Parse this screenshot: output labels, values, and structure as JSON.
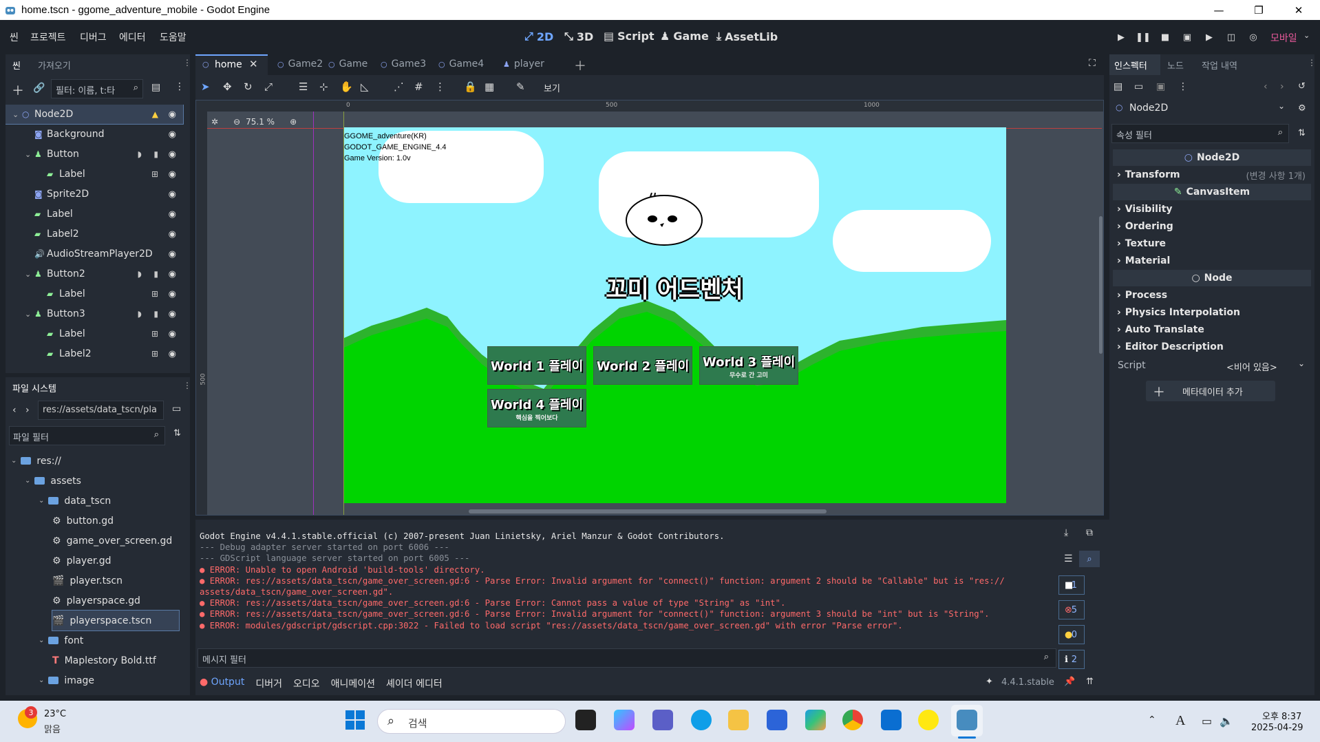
{
  "window": {
    "title": "home.tscn - ggome_adventure_mobile - Godot Engine",
    "minimize": "—",
    "maximize": "❐",
    "close": "✕"
  },
  "menu": [
    "씬",
    "프로젝트",
    "디버그",
    "에디터",
    "도움말"
  ],
  "main_screens": [
    "2D",
    "3D",
    "Script",
    "Game",
    "AssetLib"
  ],
  "renderer": "모바일",
  "scene_dock": {
    "tabs": [
      "씬",
      "가져오기"
    ],
    "filter_placeholder": "필터: 이름, t:타",
    "nodes": [
      {
        "name": "Node2D",
        "icon": "node2d-icon",
        "color": "#8da5f3"
      },
      {
        "name": "Background",
        "icon": "sprite-icon",
        "color": "#8da5f3"
      },
      {
        "name": "Button",
        "icon": "button-icon",
        "color": "#8eef97"
      },
      {
        "name": "Label",
        "icon": "label-icon",
        "color": "#8eef97"
      },
      {
        "name": "Sprite2D",
        "icon": "sprite-icon",
        "color": "#8da5f3"
      },
      {
        "name": "Label",
        "icon": "label-icon",
        "color": "#8eef97"
      },
      {
        "name": "Label2",
        "icon": "label-icon",
        "color": "#8eef97"
      },
      {
        "name": "AudioStreamPlayer2D",
        "icon": "audio-icon",
        "color": "#8da5f3"
      },
      {
        "name": "Button2",
        "icon": "button-icon",
        "color": "#8eef97"
      },
      {
        "name": "Label",
        "icon": "label-icon",
        "color": "#8eef97"
      },
      {
        "name": "Button3",
        "icon": "button-icon",
        "color": "#8eef97"
      },
      {
        "name": "Label",
        "icon": "label-icon",
        "color": "#8eef97"
      },
      {
        "name": "Label2",
        "icon": "label-icon",
        "color": "#8eef97"
      }
    ]
  },
  "filesystem": {
    "title": "파일 시스템",
    "path": "res://assets/data_tscn/pla",
    "filter_placeholder": "파일 필터",
    "items": [
      "res://",
      "assets",
      "data_tscn",
      "button.gd",
      "game_over_screen.gd",
      "player.gd",
      "player.tscn",
      "playerspace.gd",
      "playerspace.tscn",
      "font",
      "Maplestory Bold.ttf",
      "image"
    ]
  },
  "scene_tabs": [
    "home",
    "Game2",
    "Game",
    "Game3",
    "Game4",
    "player"
  ],
  "viewport": {
    "zoom": "75.1 %",
    "view_menu": "보기",
    "ruler": [
      "0",
      "500",
      "1000"
    ],
    "ruler_v": [
      "500"
    ],
    "info_lines": [
      "GGOME_adventure(KR)",
      "GODOT_GAME_ENGINE_4.4",
      "Game Version: 1.0v"
    ],
    "game_title": "꼬미 어드벤처",
    "buttons": [
      {
        "label": "World 1 플레이",
        "sub": ""
      },
      {
        "label": "World 2 플레이",
        "sub": ""
      },
      {
        "label": "World 3 플레이",
        "sub": "무수로 간 고미"
      },
      {
        "label": "World 4 플레이",
        "sub": "핵심을 찍어보다"
      }
    ]
  },
  "output": {
    "lines": [
      {
        "kind": "white",
        "text": "Godot Engine v4.4.1.stable.official (c) 2007-present Juan Linietsky, Ariel Manzur & Godot Contributors."
      },
      {
        "kind": "dim",
        "text": "--- Debug adapter server started on port 6006 ---"
      },
      {
        "kind": "dim",
        "text": "--- GDScript language server started on port 6005 ---"
      },
      {
        "kind": "err",
        "text": "● ERROR: Unable to open Android 'build-tools' directory."
      },
      {
        "kind": "err",
        "text": "● ERROR: res://assets/data_tscn/game_over_screen.gd:6 - Parse Error: Invalid argument for \"connect()\" function: argument 2 should be \"Callable\" but is \"res://"
      },
      {
        "kind": "err",
        "text": "assets/data_tscn/game_over_screen.gd\"."
      },
      {
        "kind": "err",
        "text": "● ERROR: res://assets/data_tscn/game_over_screen.gd:6 - Parse Error: Cannot pass a value of type \"String\" as \"int\"."
      },
      {
        "kind": "err",
        "text": "● ERROR: res://assets/data_tscn/game_over_screen.gd:6 - Parse Error: Invalid argument for \"connect()\" function: argument 3 should be \"int\" but is \"String\"."
      },
      {
        "kind": "err",
        "text": "● ERROR: modules/gdscript/gdscript.cpp:3022 - Failed to load script \"res://assets/data_tscn/game_over_screen.gd\" with error \"Parse error\"."
      }
    ],
    "filter_placeholder": "메시지 필터",
    "counts": [
      "1",
      "5",
      "0",
      "2"
    ],
    "bottom_tabs": [
      "Output",
      "디버거",
      "오디오",
      "애니메이션",
      "셰이더 에디터"
    ],
    "version": "4.4.1.stable"
  },
  "inspector": {
    "tabs": [
      "인스펙터",
      "노드",
      "작업 내역"
    ],
    "node": "Node2D",
    "filter_placeholder": "속성 필터",
    "sections": {
      "node2d": "Node2D",
      "canvasitem": "CanvasItem",
      "node": "Node"
    },
    "transform": "Transform",
    "transform_note": "(변경 사항 1개)",
    "canvas_props": [
      "Visibility",
      "Ordering",
      "Texture",
      "Material"
    ],
    "node_props": [
      "Process",
      "Physics Interpolation",
      "Auto Translate",
      "Editor Description"
    ],
    "script_label": "Script",
    "script_value": "<비어 있음>",
    "add_meta": "메타데이터 추가"
  },
  "taskbar": {
    "weather_temp": "23°C",
    "weather_desc": "맑음",
    "weather_badge": "3",
    "search": "검색",
    "ime": "A",
    "time": "오후 8:37",
    "date": "2025-04-29"
  }
}
